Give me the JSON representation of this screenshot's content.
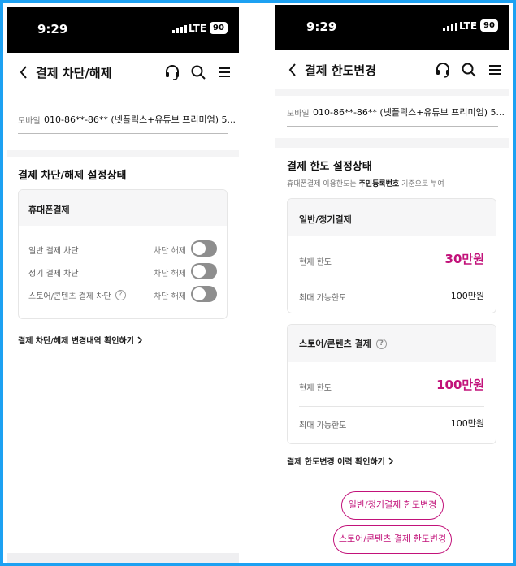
{
  "status": {
    "time": "9:29",
    "network": "LTE",
    "battery": "90"
  },
  "left": {
    "title": "결제 차단/해제",
    "mobile_label": "모바일",
    "mobile_value": "010-86**-86**   (넷플릭스+유튜브 프리미엄) 5...",
    "section_title": "결제 차단/해제 설정상태",
    "card_title": "휴대폰결제",
    "rows": [
      {
        "name": "일반 결제 차단",
        "state": "차단 해제"
      },
      {
        "name": "정기 결제 차단",
        "state": "차단 해제"
      },
      {
        "name": "스토어/콘텐츠 결제 차단",
        "state": "차단 해제"
      }
    ],
    "history_link": "결제 차단/해제 변경내역 확인하기"
  },
  "right": {
    "title": "결제 한도변경",
    "mobile_label": "모바일",
    "mobile_value": "010-86**-86**   (넷플릭스+유튜브 프리미엄) 5...",
    "section_title": "결제 한도 설정상태",
    "note_pre": "휴대폰결제 이용한도는 ",
    "note_bold": "주민등록번호",
    "note_post": " 기준으로 부여",
    "card1": {
      "title": "일반/정기결제",
      "current_label": "현재 한도",
      "current_value": "30만원",
      "max_label": "최대 가능한도",
      "max_value": "100만원"
    },
    "card2": {
      "title": "스토어/콘텐츠 결제",
      "current_label": "현재 한도",
      "current_value": "100만원",
      "max_label": "최대 가능한도",
      "max_value": "100만원"
    },
    "history_link": "결제 한도변경 이력 확인하기",
    "btn_general": "일반/정기결제 한도변경",
    "btn_store": "스토어/콘텐츠 결제 한도변경"
  },
  "colors": {
    "accent": "#c2127a",
    "frame": "#1da1f2",
    "toggle_off": "#8e8e8e"
  },
  "icons": [
    "chevron-left-icon",
    "headset-icon",
    "search-icon",
    "menu-icon",
    "question-icon",
    "chevron-right-icon"
  ]
}
